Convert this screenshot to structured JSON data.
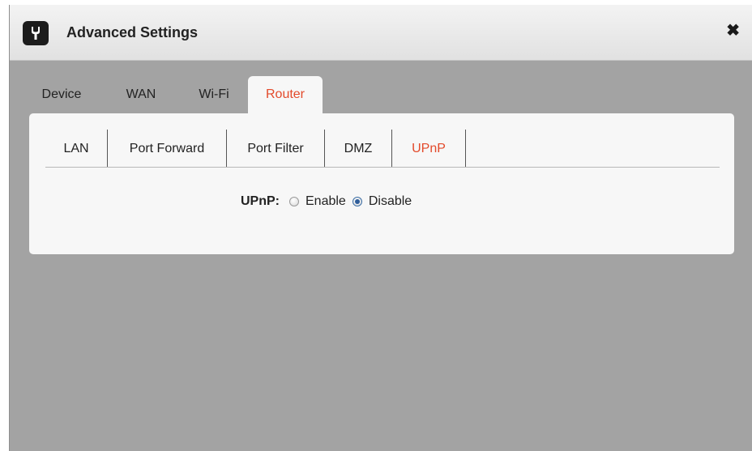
{
  "dialog": {
    "title": "Advanced Settings",
    "icon": "wrench-icon",
    "close_icon": "close-icon"
  },
  "tabs": [
    {
      "label": "Device",
      "active": false
    },
    {
      "label": "WAN",
      "active": false
    },
    {
      "label": "Wi-Fi",
      "active": false
    },
    {
      "label": "Router",
      "active": true
    }
  ],
  "subtabs": [
    {
      "label": "LAN",
      "active": false
    },
    {
      "label": "Port Forward",
      "active": false
    },
    {
      "label": "Port Filter",
      "active": false
    },
    {
      "label": "DMZ",
      "active": false
    },
    {
      "label": "UPnP",
      "active": true
    }
  ],
  "upnp": {
    "label": "UPnP:",
    "options": [
      {
        "label": "Enable",
        "checked": false
      },
      {
        "label": "Disable",
        "checked": true
      }
    ]
  },
  "colors": {
    "accent": "#e34a2b",
    "backdrop": "#a3a3a3",
    "panel": "#f7f7f7",
    "radio_selected": "#2f5d9a"
  }
}
